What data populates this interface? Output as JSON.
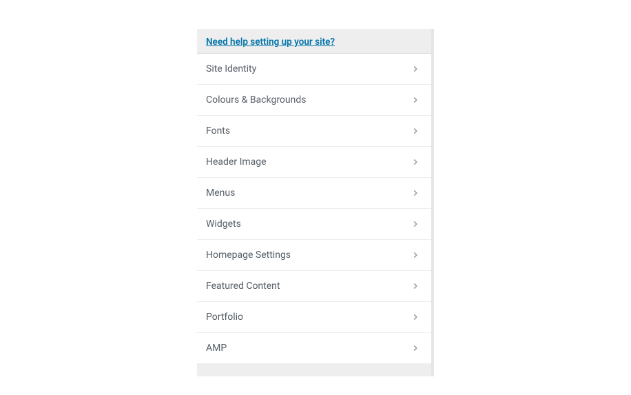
{
  "help": {
    "link_text": "Need help setting up your site?"
  },
  "menu": {
    "items": [
      {
        "label": "Site Identity"
      },
      {
        "label": "Colours & Backgrounds"
      },
      {
        "label": "Fonts"
      },
      {
        "label": "Header Image"
      },
      {
        "label": "Menus"
      },
      {
        "label": "Widgets"
      },
      {
        "label": "Homepage Settings"
      },
      {
        "label": "Featured Content"
      },
      {
        "label": "Portfolio"
      },
      {
        "label": "AMP"
      }
    ]
  }
}
